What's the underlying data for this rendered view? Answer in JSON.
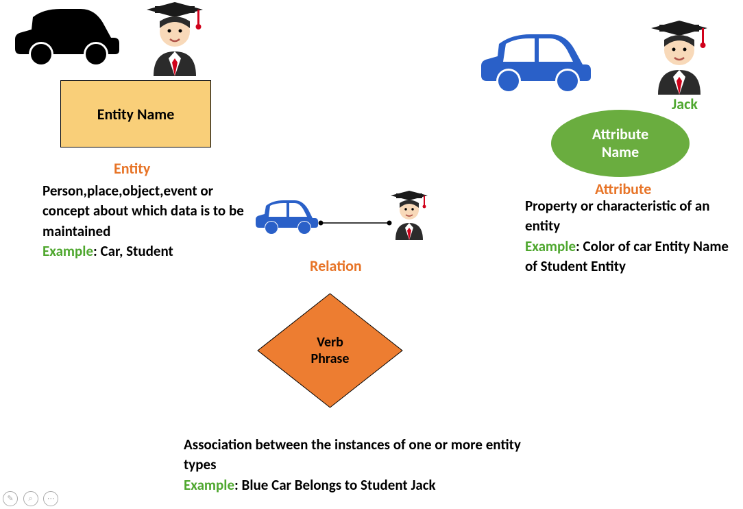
{
  "entity": {
    "box_label": "Entity Name",
    "heading": "Entity",
    "description": "Person,place,object,event or concept about which data is to be maintained",
    "example_label": "Example",
    "example_text": ": Car, Student"
  },
  "attribute": {
    "jack_label": "Jack",
    "ellipse_label_line1": "Attribute",
    "ellipse_label_line2": "Name",
    "heading": "Attribute",
    "description": "Property or characteristic of an entity",
    "example_label": "Example",
    "example_text": ": Color of car Entity Name of Student Entity"
  },
  "relation": {
    "heading": "Relation",
    "diamond_label_line1": "Verb",
    "diamond_label_line2": "Phrase",
    "description": "Association between the instances of one or more entity types",
    "example_label": "Example",
    "example_text": ": Blue Car Belongs to Student Jack"
  },
  "icons": {
    "car_black": "car-icon",
    "car_blue": "car-icon",
    "student": "student-icon"
  }
}
